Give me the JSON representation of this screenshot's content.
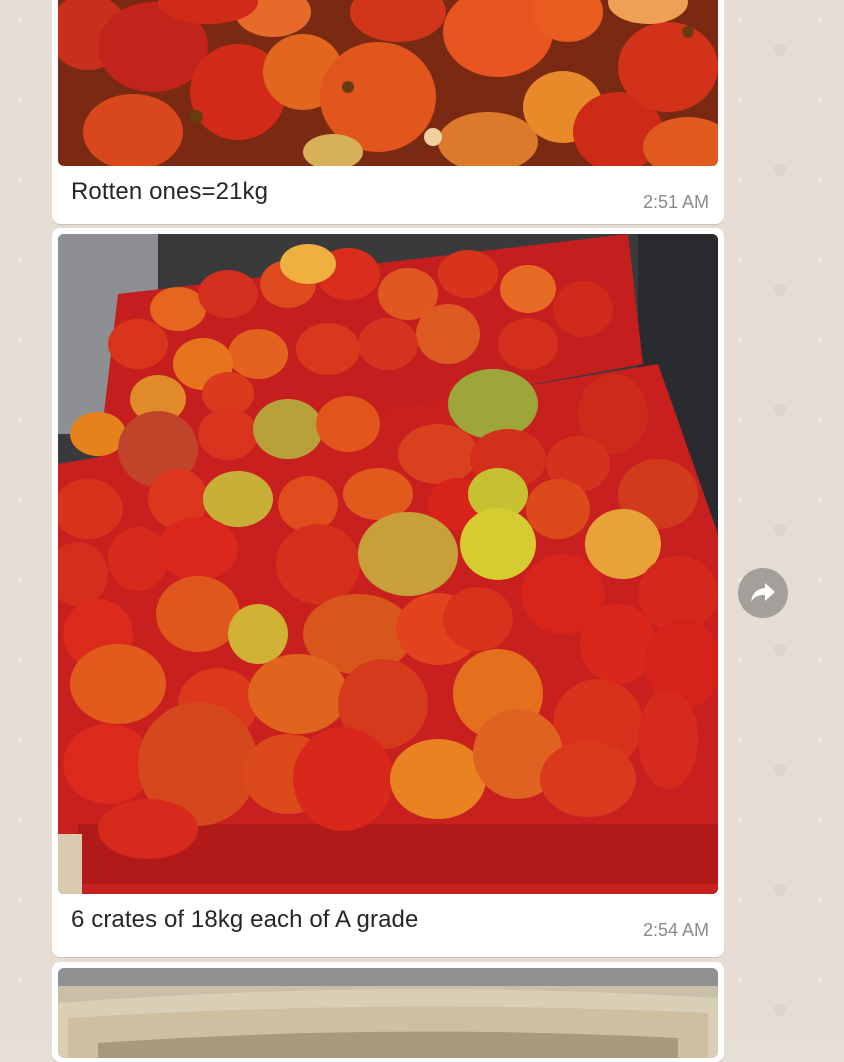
{
  "messages": [
    {
      "caption": "Rotten ones=21kg",
      "time": "2:51 AM"
    },
    {
      "caption": "6 crates of 18kg each of A grade",
      "time": "2:54 AM"
    }
  ],
  "colors": {
    "bubble": "#ffffff",
    "chat_background": "#e5ddd4",
    "timestamp": "#8a8a8a",
    "crate_red": "#c8201f",
    "tomato_red": "#d9301c"
  },
  "icons": {
    "forward": "forward-arrow-icon"
  }
}
